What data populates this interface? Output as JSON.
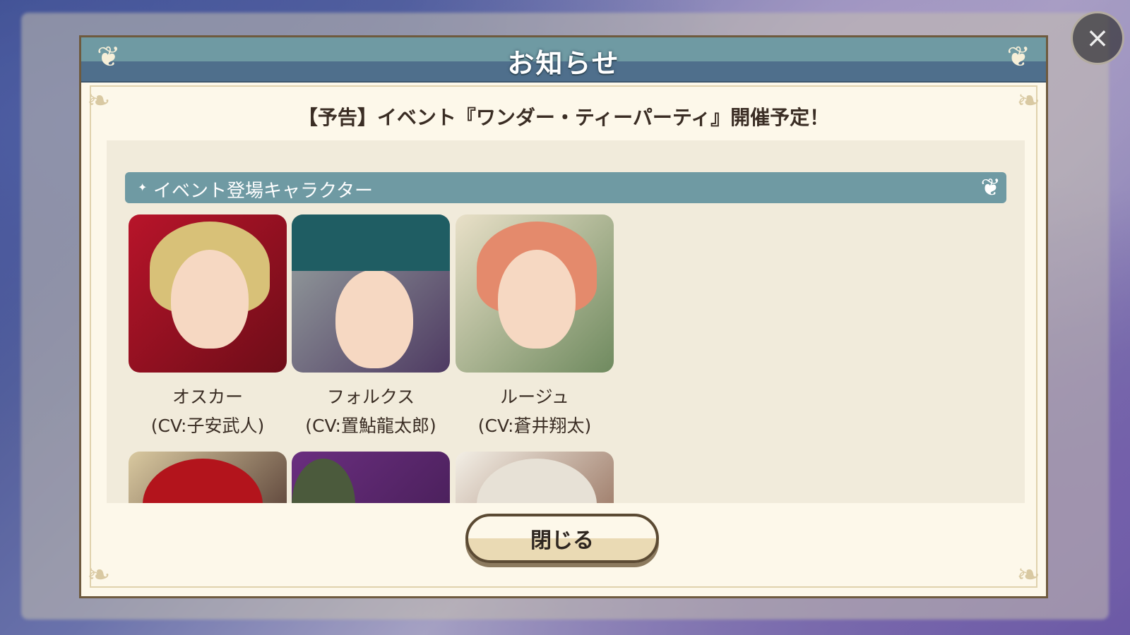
{
  "dialog": {
    "title": "お知らせ",
    "heading": "【予告】イベント『ワンダー・ティーパーティ』開催予定！",
    "section_label": "イベント登場キャラクター",
    "close_button_label": "閉じる",
    "dismiss_icon": "×"
  },
  "characters": [
    {
      "name": "オスカー",
      "cv": "(CV:子安武人)"
    },
    {
      "name": "フォルクス",
      "cv": "(CV:置鮎龍太郎)"
    },
    {
      "name": "ルージュ",
      "cv": "(CV:蒼井翔太)"
    }
  ],
  "colors": {
    "header_teal": "#6f9aa3",
    "header_navy": "#4f6f8c",
    "parchment": "#fdf8ea",
    "panel": "#f1ebdb"
  }
}
